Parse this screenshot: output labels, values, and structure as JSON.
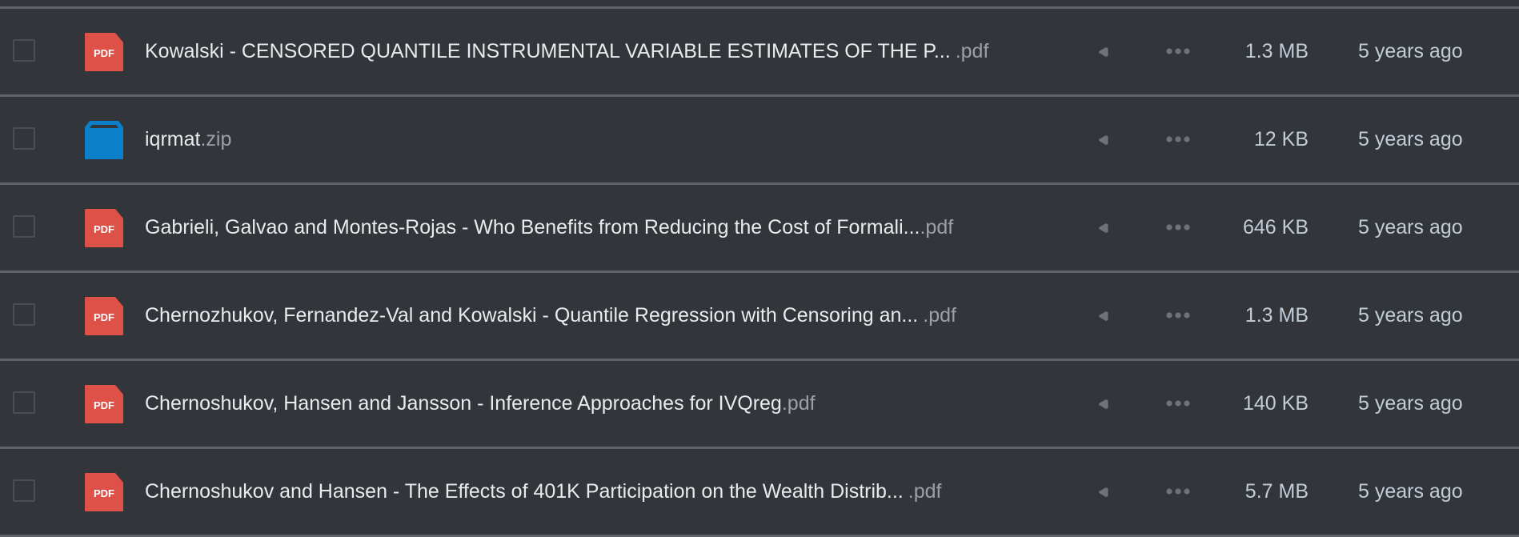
{
  "colors": {
    "background": "#32363b",
    "pdf_icon": "#dd5148",
    "zip_icon": "#0b7fc9",
    "separator": "#5f6367"
  },
  "files": [
    {
      "base": "Kowalski - CENSORED QUANTILE INSTRUMENTAL VARIABLE ESTIMATES OF THE P...",
      "ext": ".pdf",
      "type": "pdf",
      "icon_label": "PDF",
      "size": "1.3 MB",
      "modified": "5 years ago",
      "gap": true
    },
    {
      "base": "iqrmat",
      "ext": ".zip",
      "type": "zip",
      "icon_label": "",
      "size": "12 KB",
      "modified": "5 years ago",
      "gap": false
    },
    {
      "base": "Gabrieli, Galvao and Montes-Rojas - Who Benefits from Reducing the Cost of Formali...",
      "ext": ".pdf",
      "type": "pdf",
      "icon_label": "PDF",
      "size": "646 KB",
      "modified": "5 years ago",
      "gap": false
    },
    {
      "base": "Chernozhukov, Fernandez-Val and Kowalski - Quantile Regression with Censoring an...",
      "ext": ".pdf",
      "type": "pdf",
      "icon_label": "PDF",
      "size": "1.3 MB",
      "modified": "5 years ago",
      "gap": true
    },
    {
      "base": "Chernoshukov, Hansen and Jansson - Inference Approaches for IVQreg",
      "ext": ".pdf",
      "type": "pdf",
      "icon_label": "PDF",
      "size": "140 KB",
      "modified": "5 years ago",
      "gap": false
    },
    {
      "base": "Chernoshukov and Hansen - The Effects of 401K Participation on the Wealth Distrib...",
      "ext": ".pdf",
      "type": "pdf",
      "icon_label": "PDF",
      "size": "5.7 MB",
      "modified": "5 years ago",
      "gap": true
    }
  ]
}
